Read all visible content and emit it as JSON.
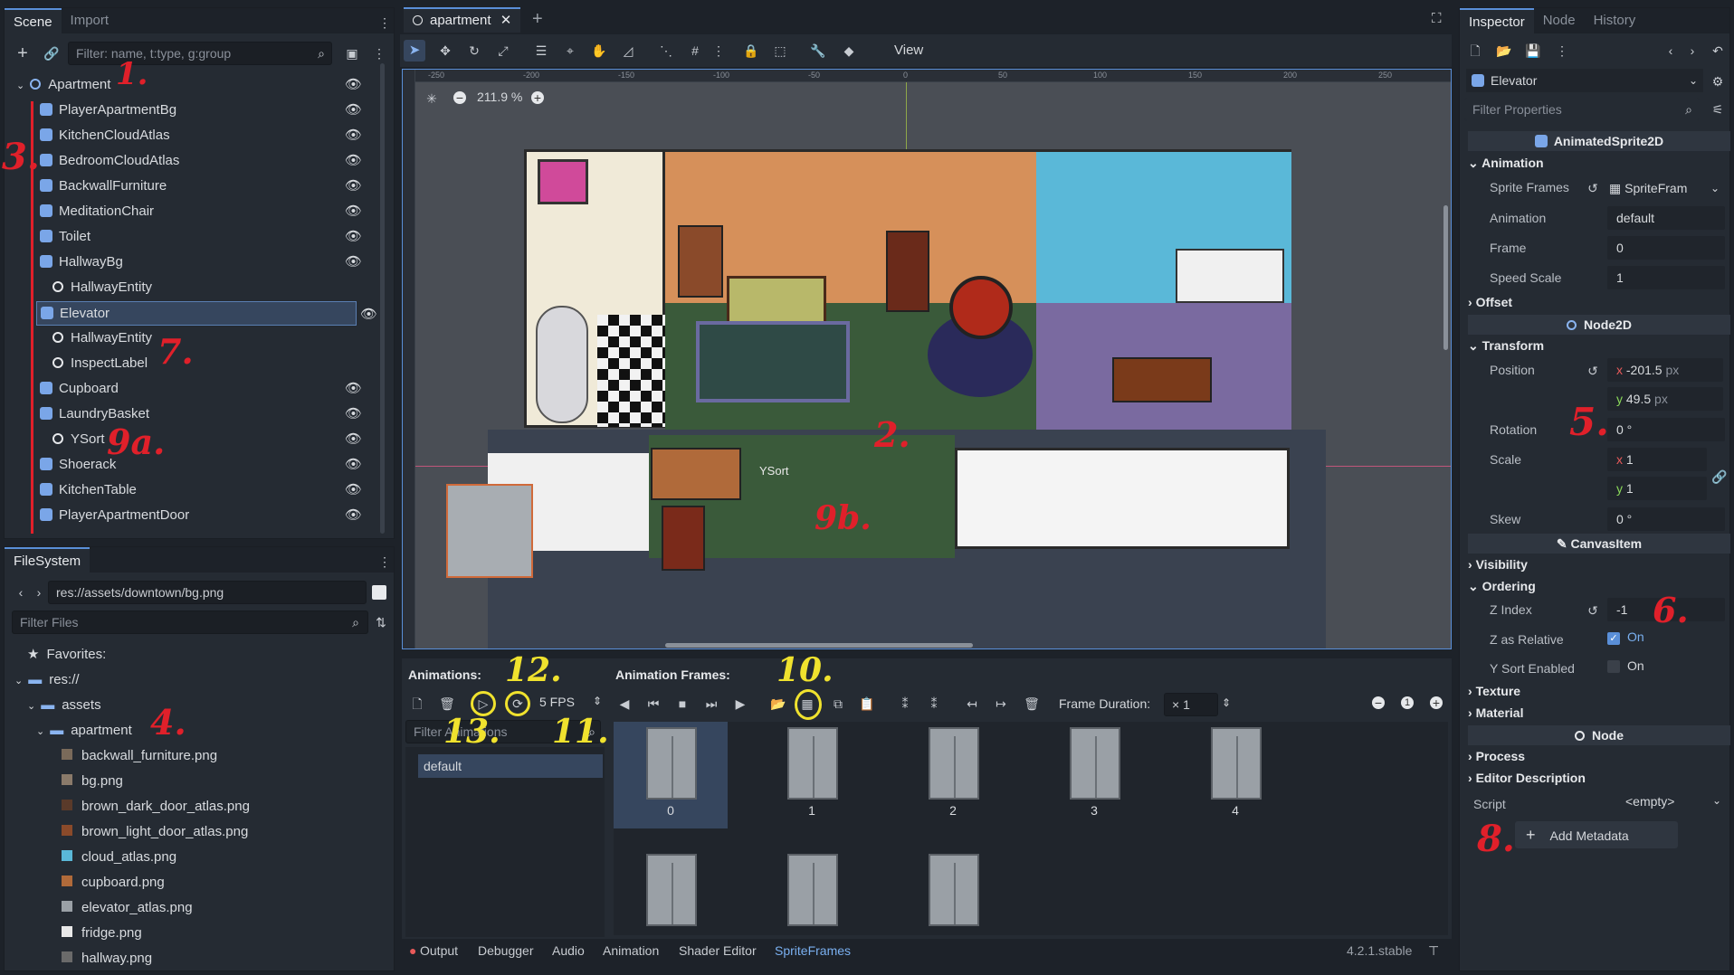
{
  "scene_panel": {
    "tabs": [
      "Scene",
      "Import"
    ],
    "filter_placeholder": "Filter: name, t:type, g:group",
    "nodes": [
      "Apartment",
      "PlayerApartmentBg",
      "KitchenCloudAtlas",
      "BedroomCloudAtlas",
      "BackwallFurniture",
      "MeditationChair",
      "Toilet",
      "HallwayBg",
      "HallwayEntity",
      "Elevator",
      "HallwayEntity",
      "InspectLabel",
      "Cupboard",
      "LaundryBasket",
      "YSort",
      "Shoerack",
      "KitchenTable",
      "PlayerApartmentDoor"
    ]
  },
  "filesystem": {
    "title": "FileSystem",
    "path": "res://assets/downtown/bg.png",
    "filter_placeholder": "Filter Files",
    "items": [
      "Favorites:",
      "res://",
      "assets",
      "apartment",
      "backwall_furniture.png",
      "bg.png",
      "brown_dark_door_atlas.png",
      "brown_light_door_atlas.png",
      "cloud_atlas.png",
      "cupboard.png",
      "elevator_atlas.png",
      "fridge.png",
      "hallway.png"
    ]
  },
  "editor": {
    "tab": "apartment",
    "toolbar_view": "View",
    "zoom": "211.9 %",
    "ruler": [
      "-250",
      "-200",
      "-150",
      "-100",
      "-50",
      "0",
      "50",
      "100",
      "150",
      "200",
      "250"
    ],
    "ysort_label": "YSort"
  },
  "frames_panel": {
    "animations_label": "Animations:",
    "frames_label": "Animation Frames:",
    "fps": "5 FPS",
    "filter_placeholder": "Filter Animations",
    "animation": "default",
    "frame_duration_label": "Frame Duration:",
    "frame_duration": "× 1",
    "frame_labels": [
      "0",
      "1",
      "2",
      "3",
      "4"
    ]
  },
  "bottom_bar": {
    "tabs": [
      "Output",
      "Debugger",
      "Audio",
      "Animation",
      "Shader Editor",
      "SpriteFrames"
    ],
    "version": "4.2.1.stable"
  },
  "inspector": {
    "tabs": [
      "Inspector",
      "Node",
      "History"
    ],
    "node": "Elevator",
    "filter_placeholder": "Filter Properties",
    "class": "AnimatedSprite2D",
    "animation_cat": "Animation",
    "sprite_frames_label": "Sprite Frames",
    "sprite_frames": "SpriteFram",
    "animation_label": "Animation",
    "animation_value": "default",
    "frame_label": "Frame",
    "frame_value": "0",
    "speed_label": "Speed Scale",
    "speed_value": "1",
    "offset": "Offset",
    "node2d": "Node2D",
    "transform": "Transform",
    "position_label": "Position",
    "pos_x": "-201.5",
    "pos_y": "49.5",
    "px": "px",
    "rotation_label": "Rotation",
    "rotation": "0 °",
    "scale_label": "Scale",
    "scale_x": "1",
    "scale_y": "1",
    "skew_label": "Skew",
    "skew": "0 °",
    "canvasitem": "CanvasItem",
    "visibility": "Visibility",
    "ordering": "Ordering",
    "zindex_label": "Z Index",
    "zindex": "-1",
    "zrel_label": "Z as Relative",
    "zrel": "On",
    "ysort_label": "Y Sort Enabled",
    "ysort": "On",
    "texture": "Texture",
    "material": "Material",
    "node_section": "Node",
    "process": "Process",
    "editor_desc": "Editor Description",
    "script_label": "Script",
    "script": "<empty>",
    "add_metadata": "Add Metadata"
  },
  "annotations": {
    "a1": "1.",
    "a2": "2.",
    "a3": "3.",
    "a4": "4.",
    "a5": "5.",
    "a6": "6.",
    "a7": "7.",
    "a8": "8.",
    "a9a": "9a.",
    "a9b": "9b.",
    "a10": "10.",
    "a11": "11.",
    "a12": "12.",
    "a13": "13."
  },
  "colors": {
    "accent": "#5a8fd8",
    "annotation_red": "#e0202a",
    "annotation_yellow": "#f0e22e"
  }
}
